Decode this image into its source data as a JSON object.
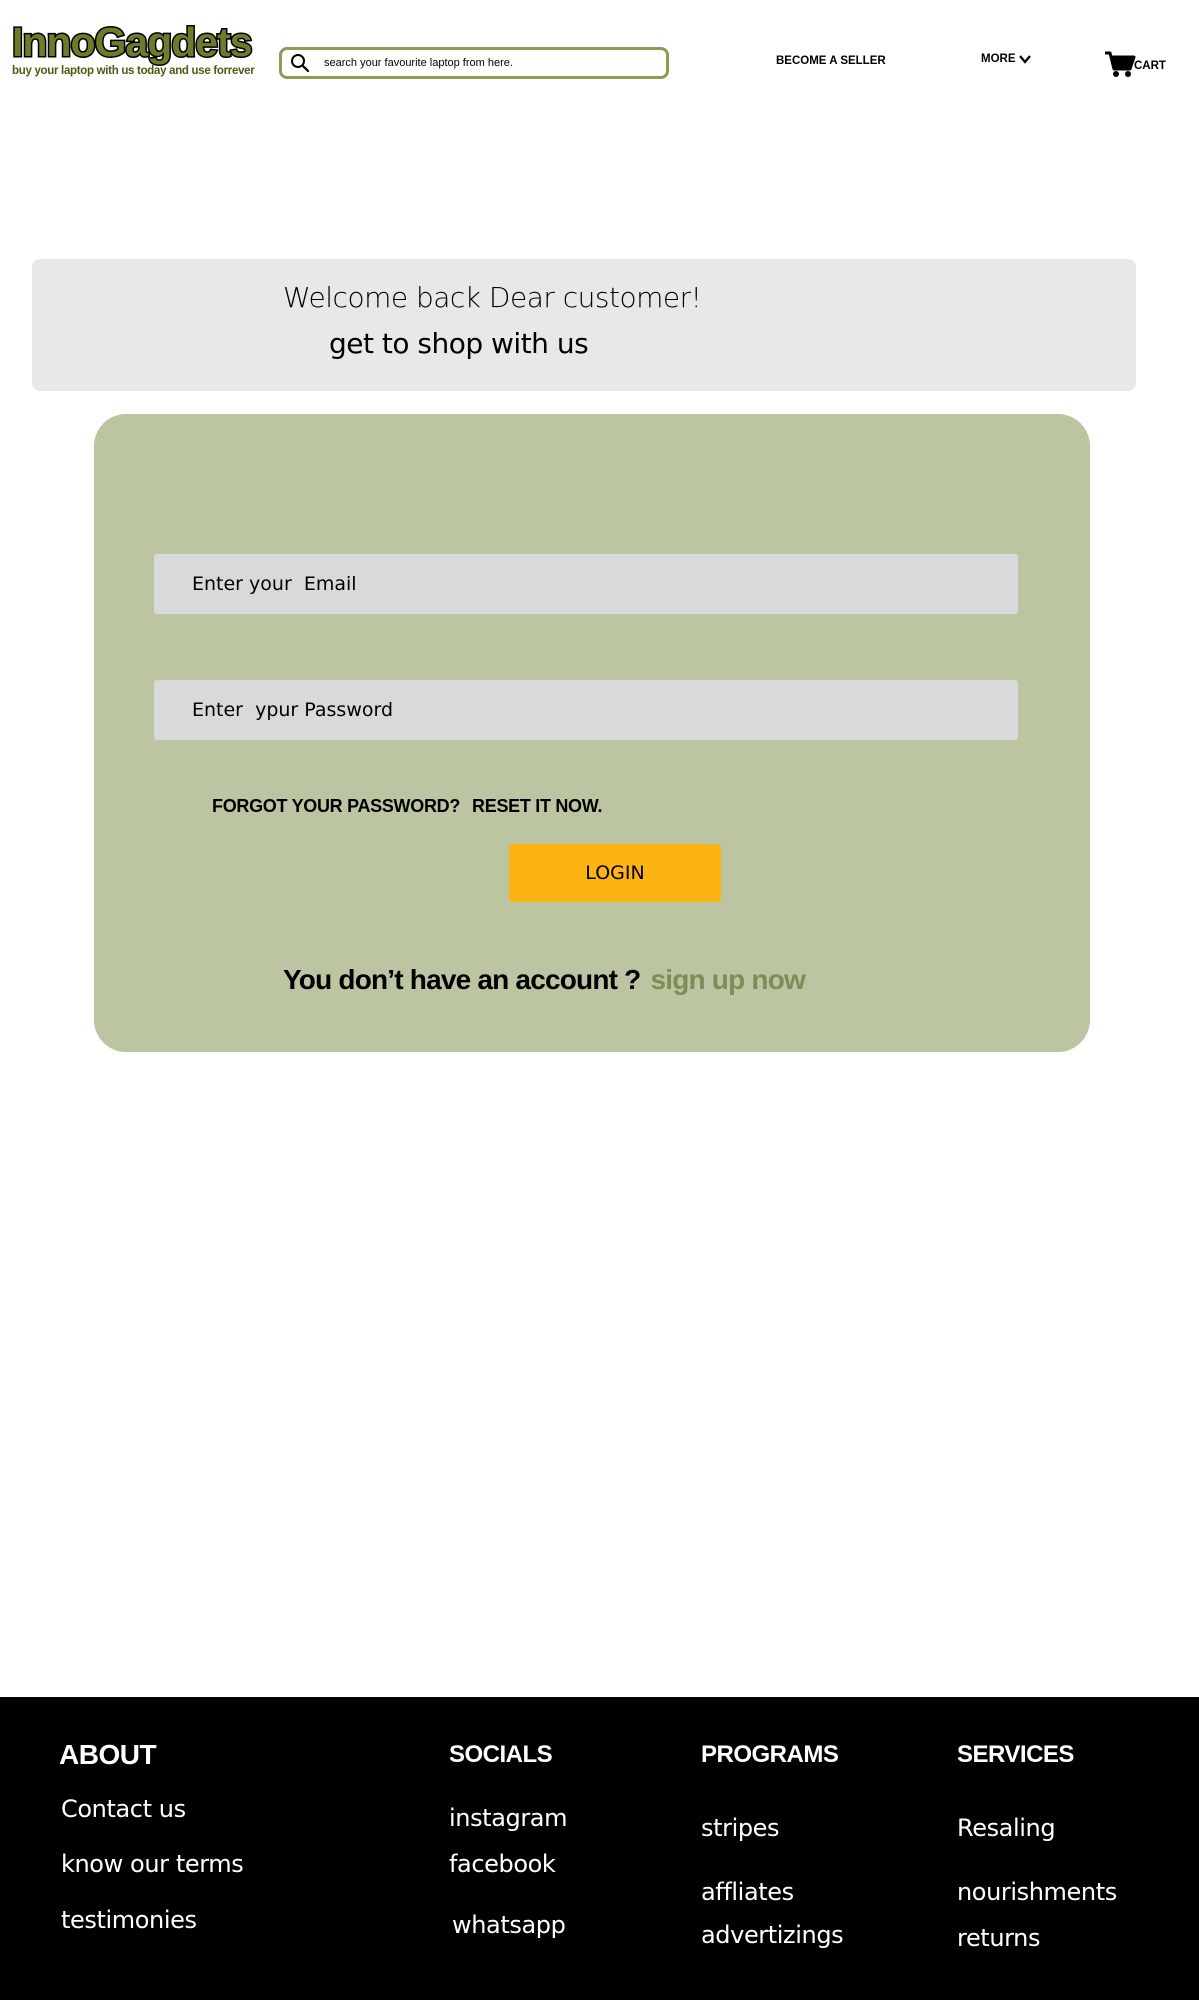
{
  "header": {
    "logo_title": "InnoGagdets",
    "logo_tagline": "buy your laptop with us  today and use forrever",
    "search_placeholder": "search your favourite laptop from here.",
    "become_seller": "BECOME A SELLER",
    "more": "MORE",
    "cart": "CART"
  },
  "banner": {
    "line1": "Welcome back Dear customer!",
    "line2": "get to shop with us"
  },
  "login": {
    "email_placeholder": "Enter your  Email",
    "password_placeholder": "Enter  ypur Password",
    "forgot_text": "FORGOT  YOUR PASSWORD?",
    "reset_link": "RESET IT NOW.",
    "login_button": "LOGIN",
    "no_account_text": "You don’t have an account ?",
    "signup_link": "sign up now"
  },
  "footer": {
    "about": {
      "heading": "ABOUT",
      "links": [
        "Contact us",
        "know our terms",
        "testimonies"
      ]
    },
    "socials": {
      "heading": "SOCIALS",
      "links": [
        "instagram",
        "facebook",
        "whatsapp"
      ]
    },
    "programs": {
      "heading": "PROGRAMS",
      "links": [
        "stripes",
        "affliates",
        "advertizings"
      ]
    },
    "services": {
      "heading": "SERVICES",
      "links": [
        "Resaling",
        "nourishments",
        "returns"
      ]
    }
  },
  "colors": {
    "brand_olive": "#6f7a2a",
    "card_green": "#bcc5a1",
    "login_yellow": "#fcb414",
    "signup_green": "#7f8c56",
    "banner_gray": "#e8e8e8",
    "footer_black": "#000000"
  }
}
